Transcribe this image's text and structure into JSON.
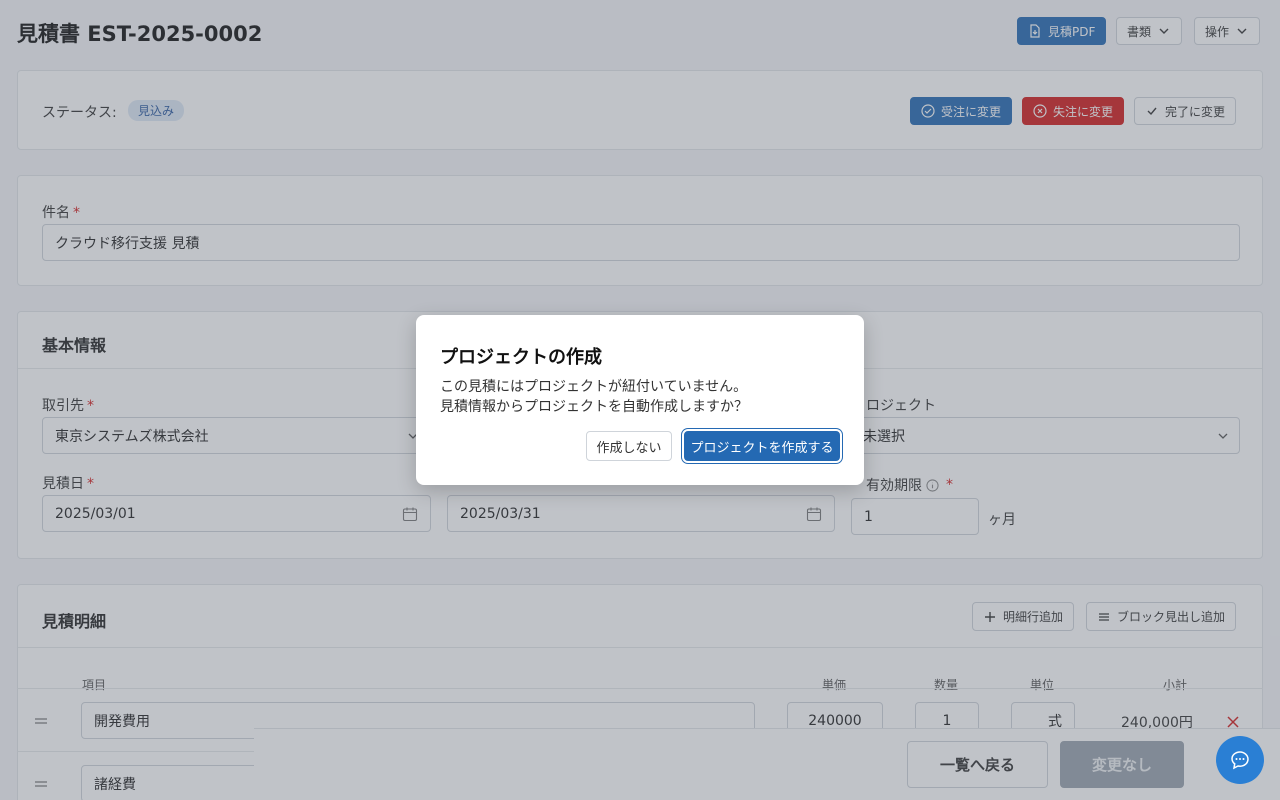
{
  "header": {
    "title": "見積書 EST-2025-0002",
    "pdf_label": "見積PDF",
    "documents_label": "書類",
    "actions_label": "操作"
  },
  "status": {
    "label": "ステータス:",
    "value": "見込み",
    "to_ordered": "受注に変更",
    "to_lost": "失注に変更",
    "to_completed": "完了に変更"
  },
  "subject": {
    "label": "件名",
    "required": "*",
    "value": "クラウド移行支援 見積"
  },
  "basic_info": {
    "title": "基本情報",
    "client_label": "取引先",
    "client_value": "東京システムズ株式会社",
    "project_label": "ロジェクト",
    "project_value": "未選択",
    "estimate_date_label": "見積日",
    "estimate_date_value": "2025/03/01",
    "delivery_date_value": "2025/03/31",
    "validity_label": "有効期限",
    "validity_value": "1",
    "validity_unit": "ヶ月",
    "required": "*"
  },
  "details": {
    "title": "見積明細",
    "add_line_label": "明細行追加",
    "add_block_label": "ブロック見出し追加",
    "columns": {
      "item": "項目",
      "unit_price": "単価",
      "quantity": "数量",
      "unit": "単位",
      "subtotal": "小計"
    },
    "rows": [
      {
        "item": "開発費用",
        "unit_price": "240000",
        "quantity": "1",
        "unit": "式",
        "subtotal": "240,000円"
      },
      {
        "item": "諸経費"
      }
    ]
  },
  "footer": {
    "back_label": "一覧へ戻る",
    "no_change_label": "変更なし"
  },
  "modal": {
    "title": "プロジェクトの作成",
    "line1": "この見積にはプロジェクトが紐付いていません。",
    "line2": "見積情報からプロジェクトを自動作成しますか？",
    "cancel_label": "作成しない",
    "confirm_label": "プロジェクトを作成する"
  },
  "colors": {
    "primary": "#2469b3",
    "danger": "#d41c1c",
    "fab": "#2a7fd4"
  }
}
